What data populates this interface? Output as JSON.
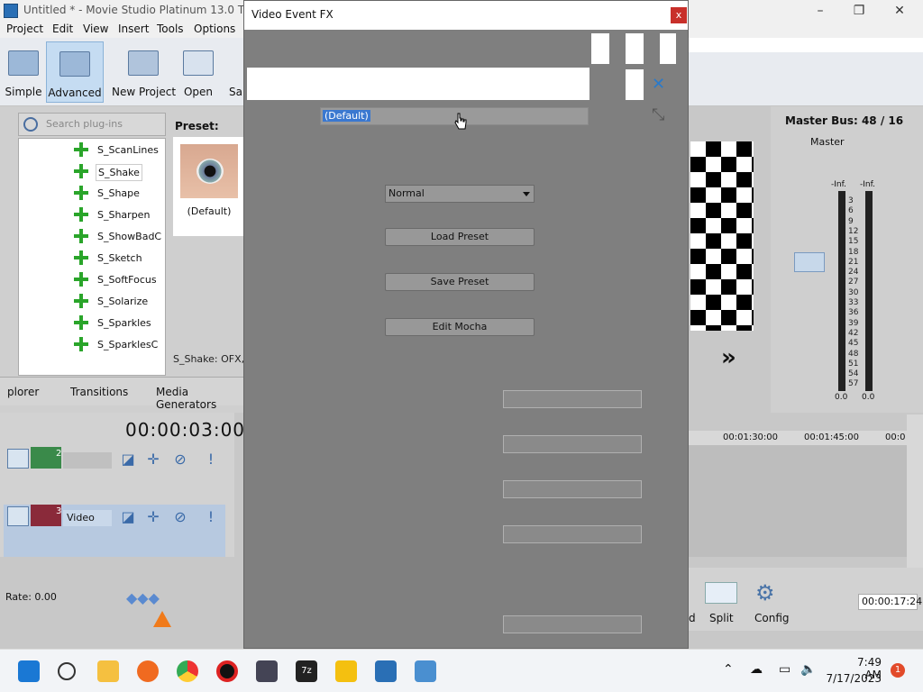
{
  "window": {
    "title": "Untitled * - Movie Studio Platinum 13.0 TRIAL"
  },
  "menu": [
    "Project",
    "Edit",
    "View",
    "Insert",
    "Tools",
    "Options"
  ],
  "toolbar": {
    "simple": "Simple",
    "advanced": "Advanced",
    "new_project": "New Project",
    "open": "Open",
    "save_partial": "Sa"
  },
  "plugins": {
    "search_placeholder": "Search plug-ins",
    "items": [
      "S_ScanLines",
      "S_Shake",
      "S_Shape",
      "S_Sharpen",
      "S_ShowBadC",
      "S_Sketch",
      "S_SoftFocus",
      "S_Solarize",
      "S_Sparkles",
      "S_SparklesC"
    ],
    "selected": "S_Shake",
    "preset_label": "Preset:",
    "preset_caption": "(Default)",
    "status": "S_Shake: OFX, :"
  },
  "tabs": [
    "plorer",
    "Transitions",
    "Media Generators"
  ],
  "timeline": {
    "timecode": "00:00:03:00",
    "tracks": [
      {
        "num": "2",
        "name": ""
      },
      {
        "num": "3",
        "name": "Video"
      }
    ],
    "rate": "Rate: 0.00",
    "ruler": [
      "00:01:30:00",
      "00:01:45:00",
      "00:0"
    ]
  },
  "dialog": {
    "title": "Video Event FX",
    "close": "x",
    "preset_value": "(Default)",
    "mode": "Normal",
    "load_preset": "Load Preset",
    "save_preset": "Save Preset",
    "edit_mocha": "Edit Mocha"
  },
  "master": {
    "title": "Master Bus: 48 / 16",
    "sub": "Master",
    "inf_l": "-Inf.",
    "inf_r": "-Inf.",
    "ticks": [
      "3",
      "6",
      "9",
      "12",
      "15",
      "18",
      "21",
      "24",
      "27",
      "30",
      "33",
      "36",
      "39",
      "42",
      "45",
      "48",
      "51",
      "54",
      "57"
    ],
    "val_l": "0.0",
    "val_r": "0.0"
  },
  "bottom": {
    "split": "Split",
    "config": "Config",
    "d_partial": "d",
    "end_time": "00:00:17:24"
  },
  "taskbar": {
    "time": "7:49 AM",
    "date": "7/17/2023",
    "notif": "1"
  },
  "colors": {
    "accent": "#3a78d0",
    "dialog_bg": "#7f7f7f"
  }
}
